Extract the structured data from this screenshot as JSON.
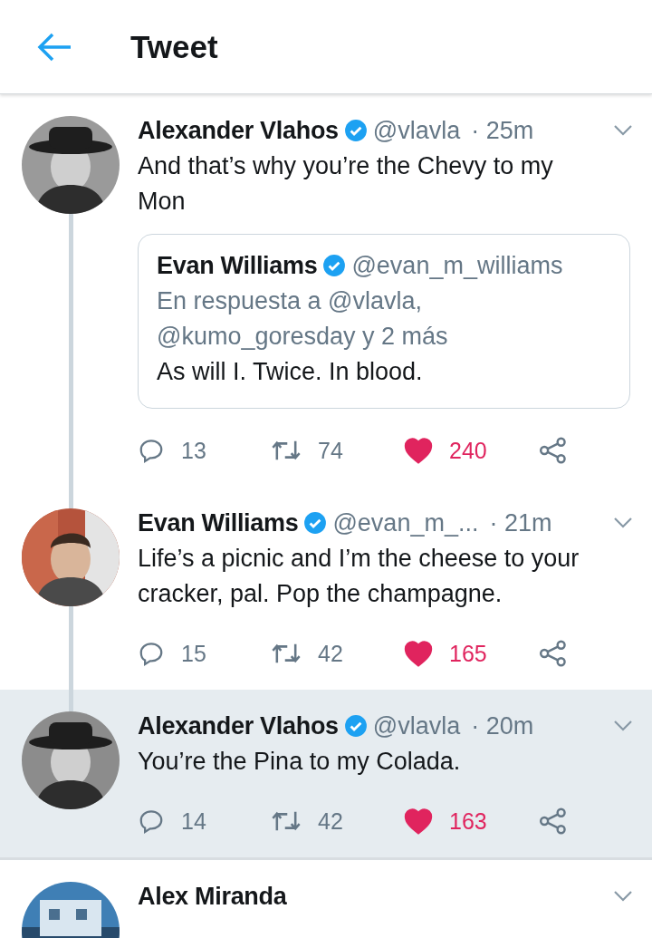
{
  "header": {
    "title": "Tweet"
  },
  "tweets": [
    {
      "name": "Alexander Vlahos",
      "verified": true,
      "handle": "@vlavla",
      "time": "· 25m",
      "text": "And that’s why you’re the Chevy to my Mon",
      "highlighted": false,
      "in_thread": true,
      "quote": {
        "name": "Evan Williams",
        "verified": true,
        "handle": "@evan_m_williams",
        "reply_to": "En respuesta a @vlavla, @kumo_goresday y 2 más",
        "text": "As will I. Twice. In blood."
      },
      "stats": {
        "replies": "13",
        "retweets": "74",
        "likes": "240",
        "liked": true
      }
    },
    {
      "name": "Evan Williams",
      "verified": true,
      "handle": "@evan_m_...",
      "time": "· 21m",
      "text": "Life’s a picnic and I’m the cheese to your cracker, pal. Pop the champagne.",
      "highlighted": false,
      "in_thread": true,
      "stats": {
        "replies": "15",
        "retweets": "42",
        "likes": "165",
        "liked": true
      }
    },
    {
      "name": "Alexander Vlahos",
      "verified": true,
      "handle": "@vlavla",
      "time": "· 20m",
      "text": "You’re the Pina to my Colada.",
      "highlighted": true,
      "in_thread": true,
      "stats": {
        "replies": "14",
        "retweets": "42",
        "likes": "163",
        "liked": true
      }
    },
    {
      "name": "Alex Miranda",
      "verified": false,
      "highlighted": false,
      "in_thread": false
    }
  ]
}
